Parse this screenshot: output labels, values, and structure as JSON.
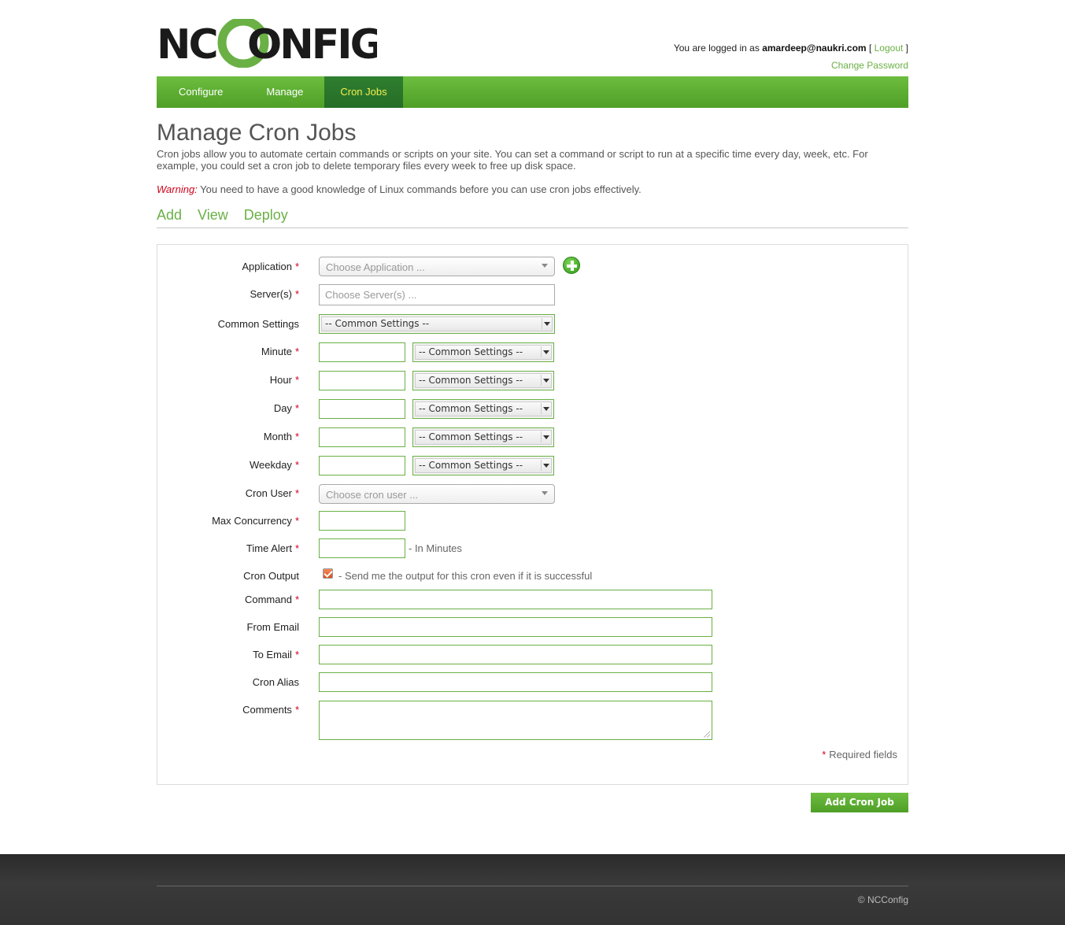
{
  "header": {
    "logo_text": "NCCONFIG",
    "logged_in_prefix": "You are logged in as",
    "user": "amardeep@naukri.com",
    "logout_label": "Logout",
    "change_password_label": "Change Password"
  },
  "nav": {
    "items": [
      {
        "label": "Configure"
      },
      {
        "label": "Manage"
      },
      {
        "label": "Cron Jobs"
      }
    ],
    "active": "Cron Jobs"
  },
  "page": {
    "title": "Manage Cron Jobs",
    "description": "Cron jobs allow you to automate certain commands or scripts on your site. You can set a command or script to run at a specific time every day, week, etc. For example, you could set a cron job to delete temporary files every week to free up disk space.",
    "warning_label": "Warning:",
    "warning_text": " You need to have a good knowledge of Linux commands before you can use cron jobs effectively."
  },
  "subtabs": [
    "Add",
    "View",
    "Deploy"
  ],
  "form": {
    "required_marker": "*",
    "application": {
      "label": "Application",
      "placeholder": "Choose Application ..."
    },
    "servers": {
      "label": "Server(s)",
      "placeholder": "Choose Server(s) ..."
    },
    "common_settings": {
      "label": "Common Settings",
      "value": "-- Common Settings --"
    },
    "minute": {
      "label": "Minute",
      "select": "-- Common Settings --"
    },
    "hour": {
      "label": "Hour",
      "select": "-- Common Settings --"
    },
    "day": {
      "label": "Day",
      "select": "-- Common Settings --"
    },
    "month": {
      "label": "Month",
      "select": "-- Common Settings --"
    },
    "weekday": {
      "label": "Weekday",
      "select": "-- Common Settings --"
    },
    "cron_user": {
      "label": "Cron User",
      "placeholder": "Choose cron user ..."
    },
    "max_concurrency": {
      "label": "Max Concurrency"
    },
    "time_alert": {
      "label": "Time Alert",
      "note": "- In Minutes"
    },
    "cron_output": {
      "label": "Cron Output",
      "note": "- Send me the output for this cron even if it is successful",
      "checked": true
    },
    "command": {
      "label": "Command"
    },
    "from_email": {
      "label": "From Email"
    },
    "to_email": {
      "label": "To Email"
    },
    "cron_alias": {
      "label": "Cron Alias"
    },
    "comments": {
      "label": "Comments"
    },
    "required_fields_note": "Required fields",
    "submit_label": "Add Cron Job"
  },
  "footer": {
    "copyright": "© NCConfig"
  },
  "colors": {
    "brand_green": "#6ab045",
    "nav_active": "#2e7d32",
    "required": "#d0021b"
  }
}
